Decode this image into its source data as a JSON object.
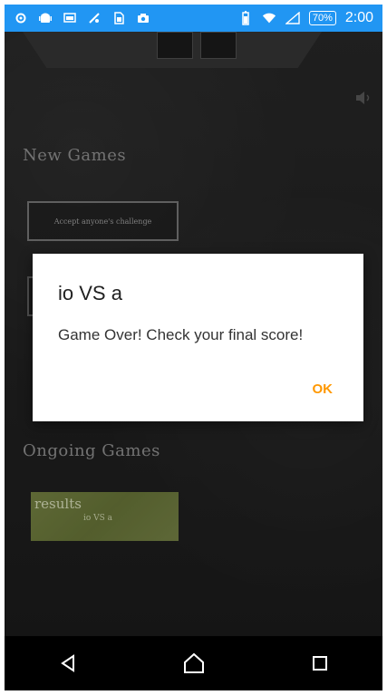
{
  "status_bar": {
    "battery": "70%",
    "time": "2:00"
  },
  "main": {
    "new_games_title": "New Games",
    "challenge_button": "Accept anyone's challenge",
    "ongoing_games_title": "Ongoing Games",
    "result_card": {
      "title": "results",
      "subtitle": "io VS a"
    }
  },
  "dialog": {
    "title": "io VS a",
    "message": "Game Over! Check your final score!",
    "ok_label": "OK"
  },
  "icons": {
    "status_left": [
      "settings-icon",
      "android-icon",
      "screen-icon",
      "notification-icon",
      "sim-icon",
      "camera-icon"
    ],
    "status_right": [
      "battery-icon",
      "wifi-icon",
      "signal-icon"
    ],
    "nav": [
      "back-icon",
      "home-icon",
      "recents-icon"
    ]
  },
  "colors": {
    "status_bar": "#2196f3",
    "dialog_accent": "#ff9800",
    "result_card": "#7d8b47"
  }
}
